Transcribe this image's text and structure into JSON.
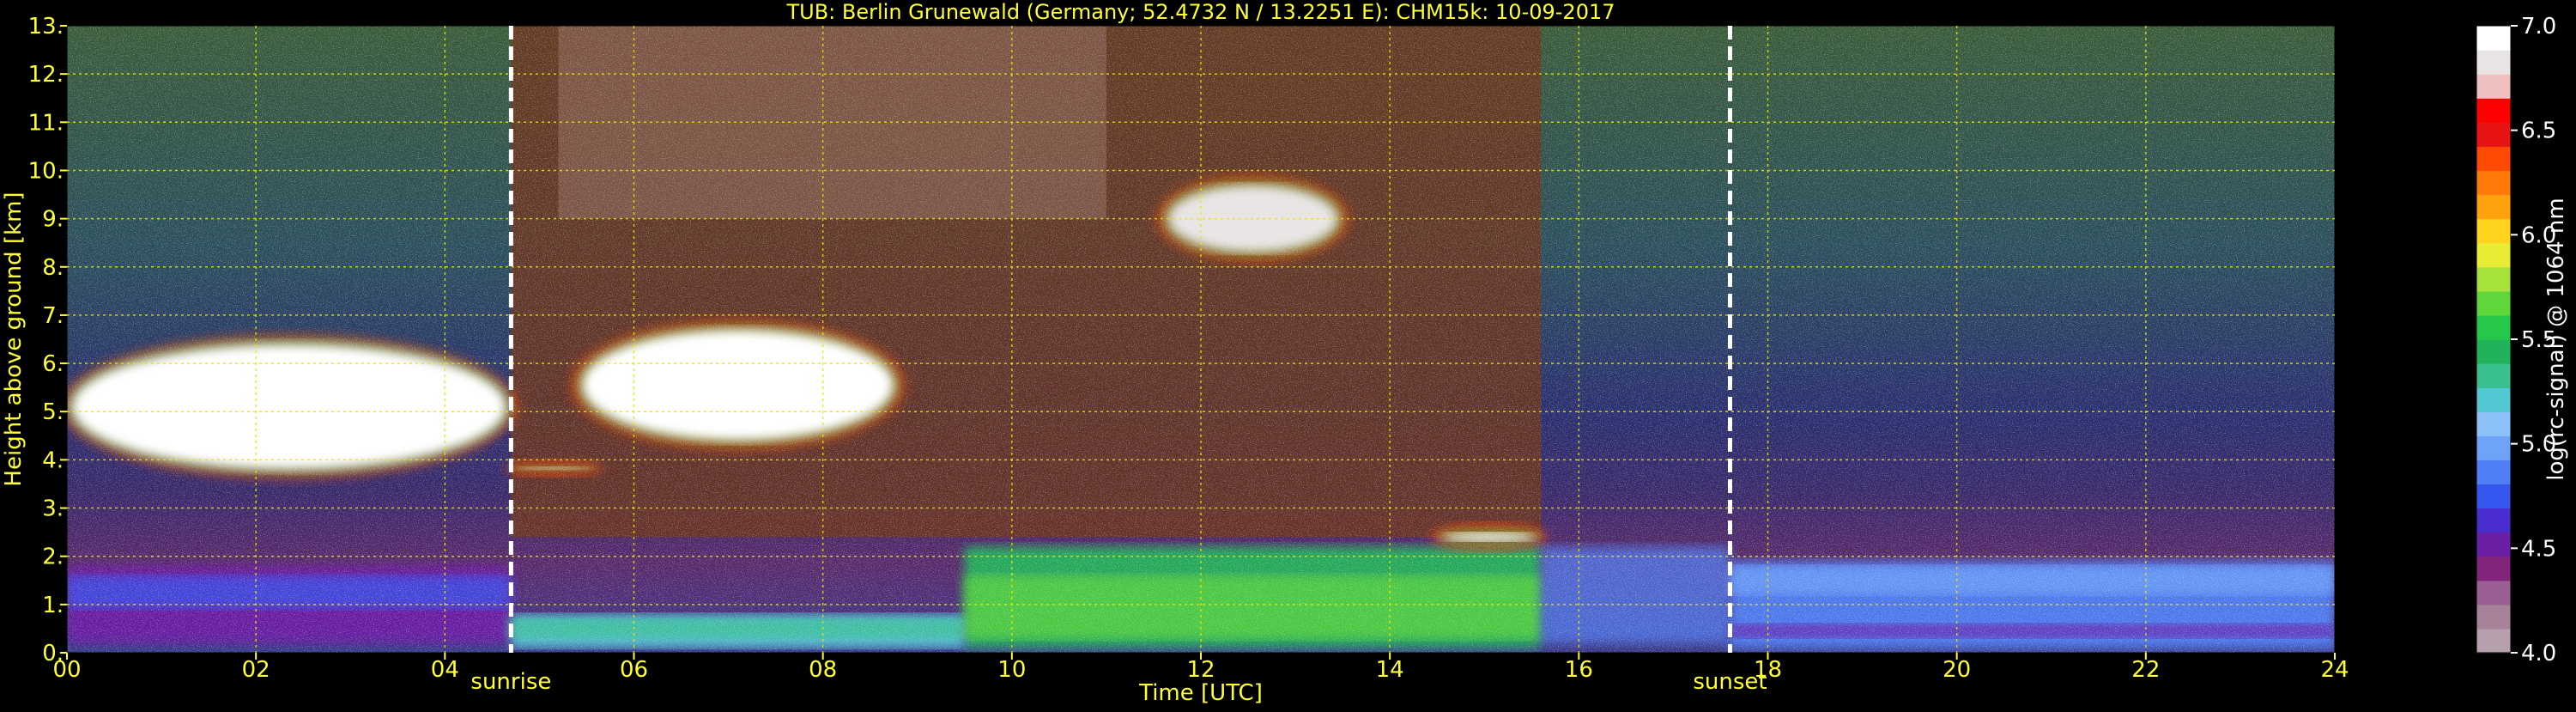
{
  "chart_data": {
    "type": "heatmap",
    "title": "TUB: Berlin Grunewald (Germany; 52.4732 N / 13.2251 E):    CHM15k: 10-09-2017",
    "xlabel": "Time [UTC]",
    "ylabel": "Height above ground [km]",
    "xlim": [
      0,
      24
    ],
    "ylim": [
      0,
      13
    ],
    "x_ticks": [
      {
        "value": 0,
        "label": "00"
      },
      {
        "value": 2,
        "label": "02"
      },
      {
        "value": 4,
        "label": "04"
      },
      {
        "value": 6,
        "label": "06"
      },
      {
        "value": 8,
        "label": "08"
      },
      {
        "value": 10,
        "label": "10"
      },
      {
        "value": 12,
        "label": "12"
      },
      {
        "value": 14,
        "label": "14"
      },
      {
        "value": 16,
        "label": "16"
      },
      {
        "value": 18,
        "label": "18"
      },
      {
        "value": 20,
        "label": "20"
      },
      {
        "value": 22,
        "label": "22"
      },
      {
        "value": 24,
        "label": "24"
      }
    ],
    "y_ticks": [
      {
        "value": 0,
        "label": "0."
      },
      {
        "value": 1,
        "label": "1."
      },
      {
        "value": 2,
        "label": "2."
      },
      {
        "value": 3,
        "label": "3."
      },
      {
        "value": 4,
        "label": "4."
      },
      {
        "value": 5,
        "label": "5."
      },
      {
        "value": 6,
        "label": "6."
      },
      {
        "value": 7,
        "label": "7."
      },
      {
        "value": 8,
        "label": "8."
      },
      {
        "value": 9,
        "label": "9."
      },
      {
        "value": 10,
        "label": "10."
      },
      {
        "value": 11,
        "label": "11."
      },
      {
        "value": 12,
        "label": "12."
      },
      {
        "value": 13,
        "label": "13."
      }
    ],
    "grid": true,
    "grid_x": [
      2,
      4,
      6,
      8,
      10,
      12,
      14,
      16,
      18,
      20,
      22
    ],
    "grid_y": [
      1,
      2,
      3,
      4,
      5,
      6,
      7,
      8,
      9,
      10,
      11,
      12
    ],
    "events": [
      {
        "name": "sunrise",
        "label": "sunrise",
        "time": 4.7
      },
      {
        "name": "sunset",
        "label": "sunset",
        "time": 17.6
      }
    ],
    "colorbar": {
      "label": "log(rc-signal) @ 1064 nm",
      "range": [
        4.0,
        7.0
      ],
      "ticks": [
        {
          "value": 4.0,
          "label": "4.0"
        },
        {
          "value": 4.5,
          "label": "4.5"
        },
        {
          "value": 5.0,
          "label": "5.0"
        },
        {
          "value": 5.5,
          "label": "5.5"
        },
        {
          "value": 6.0,
          "label": "6.0"
        },
        {
          "value": 6.5,
          "label": "6.5"
        },
        {
          "value": 7.0,
          "label": "7.0"
        }
      ],
      "colors": [
        "#b7a0ad",
        "#a88299",
        "#9a5f94",
        "#82247a",
        "#6a1fa4",
        "#4a2ccf",
        "#3656f0",
        "#4f7ff5",
        "#6fa3f8",
        "#8dc1fa",
        "#52c9d2",
        "#38c08e",
        "#22b35a",
        "#26c84a",
        "#5fd63a",
        "#a6e23a",
        "#e8ec35",
        "#ffd21e",
        "#ffa20d",
        "#ff7a08",
        "#ff4a06",
        "#e81414",
        "#ff0000",
        "#f0c0c0",
        "#e8e4e4",
        "#ffffff"
      ]
    },
    "signal_regions": [
      {
        "name": "residual-layer-night-1",
        "x": [
          0.0,
          4.7
        ],
        "y": [
          0.2,
          1.8
        ],
        "level": 4.5
      },
      {
        "name": "boundary-layer-night-2",
        "x": [
          17.6,
          24.0
        ],
        "y": [
          0.1,
          1.9
        ],
        "level": 4.9
      },
      {
        "name": "convective-boundary-layer",
        "x": [
          9.5,
          15.6
        ],
        "y": [
          0.1,
          2.2
        ],
        "level": 5.4
      },
      {
        "name": "morning-boundary-layer",
        "x": [
          4.7,
          9.5
        ],
        "y": [
          0.1,
          0.8
        ],
        "level": 5.2
      },
      {
        "name": "mid-level-cloud-night",
        "x": [
          0.0,
          4.7
        ],
        "y": [
          3.7,
          6.5
        ],
        "level": 7.0
      },
      {
        "name": "mid-level-cloud-morning",
        "x": [
          5.4,
          8.8
        ],
        "y": [
          4.3,
          6.8
        ],
        "level": 7.0
      },
      {
        "name": "cirrus-midday",
        "x": [
          11.6,
          13.5
        ],
        "y": [
          8.2,
          9.8
        ],
        "level": 6.8
      },
      {
        "name": "cloud-top-afternoon",
        "x": [
          14.5,
          15.6
        ],
        "y": [
          2.2,
          2.6
        ],
        "level": 6.9
      },
      {
        "name": "thin-layer-sunrise",
        "x": [
          4.7,
          5.6
        ],
        "y": [
          3.75,
          3.9
        ],
        "level": 6.9
      }
    ]
  }
}
